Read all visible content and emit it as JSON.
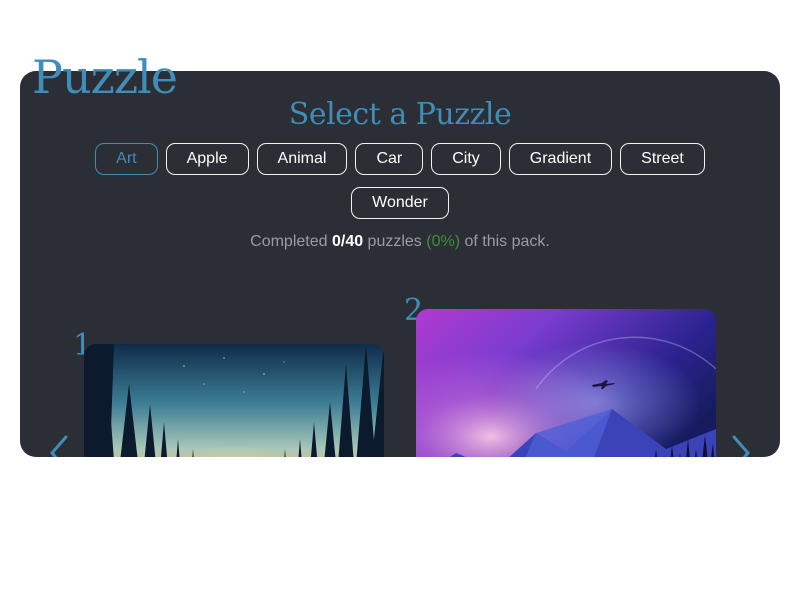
{
  "app": {
    "title": "Puzzle"
  },
  "selector": {
    "heading": "Select a Puzzle",
    "categories": [
      {
        "label": "Art",
        "active": true
      },
      {
        "label": "Apple"
      },
      {
        "label": "Animal"
      },
      {
        "label": "Car"
      },
      {
        "label": "City"
      },
      {
        "label": "Gradient"
      },
      {
        "label": "Street"
      },
      {
        "label": "Wonder"
      }
    ],
    "progress": {
      "prefix": "Completed ",
      "count": "0/40",
      "middle": " puzzles ",
      "percent": "(0%)",
      "suffix": " of this pack."
    }
  },
  "carousel": {
    "cards": [
      {
        "number": "1",
        "image": "forest-sunset-illustration"
      },
      {
        "number": "2",
        "image": "purple-mountain-night-illustration"
      }
    ],
    "prev_icon": "chevron-left-icon",
    "next_icon": "chevron-right-icon"
  },
  "colors": {
    "accent": "#3f8db8",
    "panel_bg": "#2b2e35",
    "success": "#3f8f3a"
  }
}
